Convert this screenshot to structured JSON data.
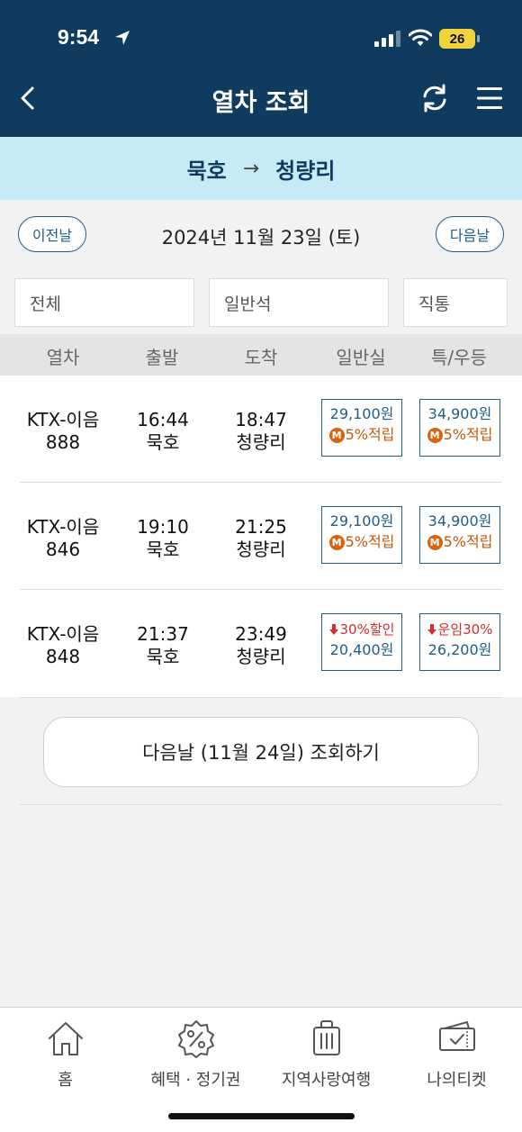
{
  "status": {
    "time": "9:54",
    "battery": "26"
  },
  "header": {
    "title": "열차 조회"
  },
  "route": {
    "from": "묵호",
    "arrow": "→",
    "to": "청량리"
  },
  "date_row": {
    "prev": "이전날",
    "date": "2024년 11월 23일 (토)",
    "next": "다음날"
  },
  "filters": {
    "type": "전체",
    "seat": "일반석",
    "direct": "직통"
  },
  "columns": [
    "열차",
    "출발",
    "도착",
    "일반실",
    "특/우등"
  ],
  "trains": [
    {
      "name": "KTX-이음",
      "number": "888",
      "dep_time": "16:44",
      "dep_station": "묵호",
      "arr_time": "18:47",
      "arr_station": "청량리",
      "general": {
        "price": "29,100원",
        "badge": "M",
        "note": "5%적립"
      },
      "special": {
        "price": "34,900원",
        "badge": "M",
        "note": "5%적립"
      }
    },
    {
      "name": "KTX-이음",
      "number": "846",
      "dep_time": "19:10",
      "dep_station": "묵호",
      "arr_time": "21:25",
      "arr_station": "청량리",
      "general": {
        "price": "29,100원",
        "badge": "M",
        "note": "5%적립"
      },
      "special": {
        "price": "34,900원",
        "badge": "M",
        "note": "5%적립"
      }
    },
    {
      "name": "KTX-이음",
      "number": "848",
      "dep_time": "21:37",
      "dep_station": "묵호",
      "arr_time": "23:49",
      "arr_station": "청량리",
      "general": {
        "discount": "30%할인",
        "price": "20,400원"
      },
      "special": {
        "discount": "운임30%",
        "price": "26,200원"
      }
    }
  ],
  "next_day_button": "다음날 (11월 24일) 조회하기",
  "nav": [
    {
      "label": "홈",
      "icon": "home-icon"
    },
    {
      "label": "혜택 · 정기권",
      "icon": "discount-badge-icon"
    },
    {
      "label": "지역사랑여행",
      "icon": "luggage-icon"
    },
    {
      "label": "나의티켓",
      "icon": "ticket-icon"
    }
  ],
  "colors": {
    "header": "#0f3c5e",
    "route_bar": "#c6ebf4",
    "accent": "#1f5d86",
    "point": "#d7640f",
    "discount": "#d62c2c"
  }
}
